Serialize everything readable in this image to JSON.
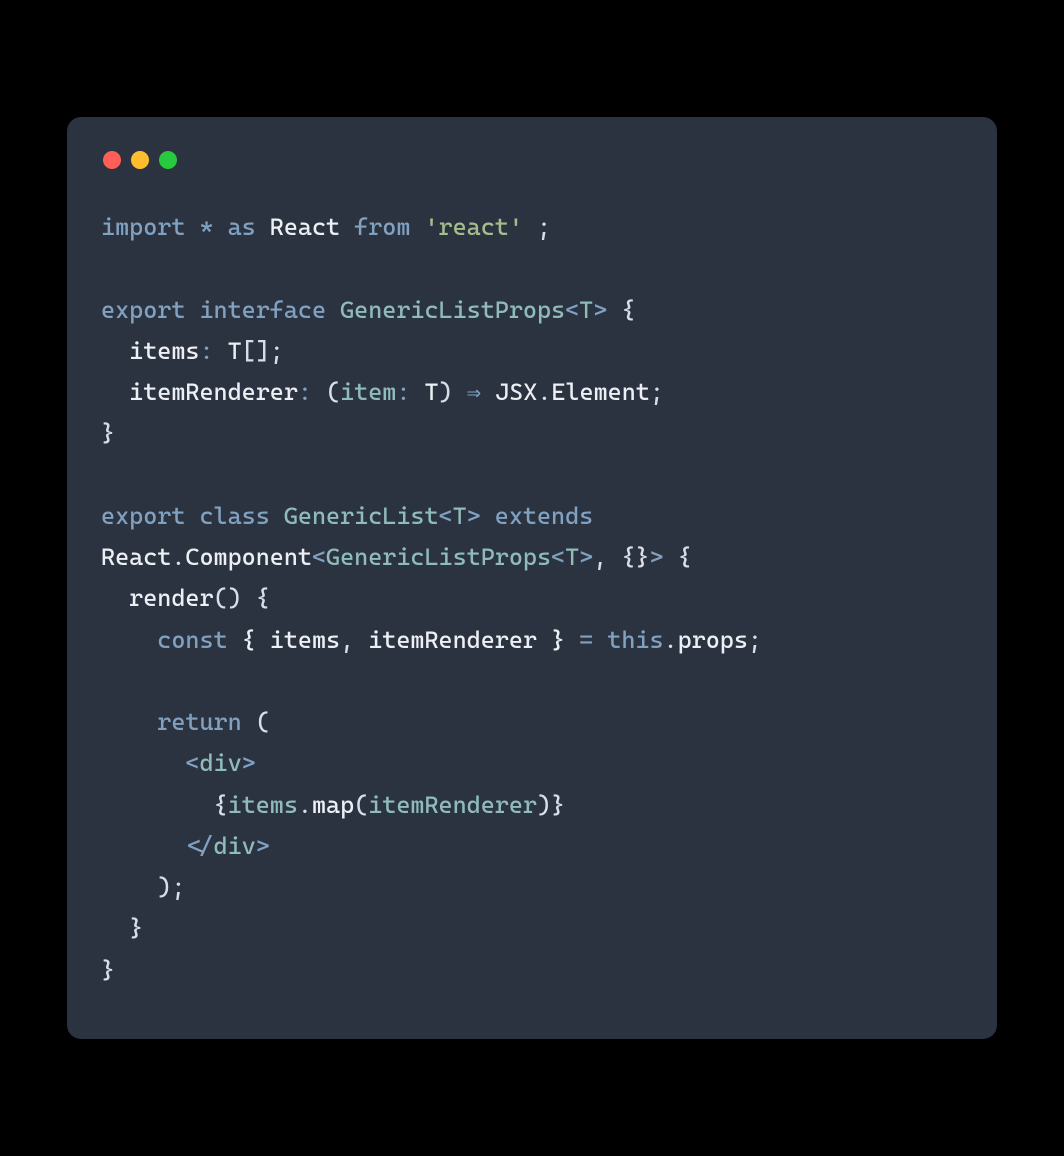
{
  "window": {
    "traffic_lights": [
      "close",
      "minimize",
      "zoom"
    ]
  },
  "code": {
    "tokens": [
      [
        {
          "t": "import",
          "c": "tok-kw"
        },
        {
          "t": " ",
          "c": ""
        },
        {
          "t": "*",
          "c": "tok-op"
        },
        {
          "t": " ",
          "c": ""
        },
        {
          "t": "as",
          "c": "tok-kw"
        },
        {
          "t": " ",
          "c": ""
        },
        {
          "t": "React",
          "c": "tok-plain"
        },
        {
          "t": " ",
          "c": ""
        },
        {
          "t": "from",
          "c": "tok-kw"
        },
        {
          "t": " ",
          "c": ""
        },
        {
          "t": "'react'",
          "c": "tok-str"
        },
        {
          "t": " ;",
          "c": "tok-punct"
        }
      ],
      [],
      [
        {
          "t": "export",
          "c": "tok-kw"
        },
        {
          "t": " ",
          "c": ""
        },
        {
          "t": "interface",
          "c": "tok-kw"
        },
        {
          "t": " ",
          "c": ""
        },
        {
          "t": "GenericListProps",
          "c": "tok-type"
        },
        {
          "t": "<",
          "c": "tok-angle"
        },
        {
          "t": "T",
          "c": "tok-type"
        },
        {
          "t": ">",
          "c": "tok-angle"
        },
        {
          "t": " {",
          "c": "tok-punct"
        }
      ],
      [
        {
          "t": "  items",
          "c": "tok-plain"
        },
        {
          "t": ":",
          "c": "tok-op"
        },
        {
          "t": " T",
          "c": "tok-plain"
        },
        {
          "t": "[];",
          "c": "tok-punct"
        }
      ],
      [
        {
          "t": "  itemRenderer",
          "c": "tok-plain"
        },
        {
          "t": ":",
          "c": "tok-op"
        },
        {
          "t": " (",
          "c": "tok-punct"
        },
        {
          "t": "item",
          "c": "tok-type"
        },
        {
          "t": ":",
          "c": "tok-op"
        },
        {
          "t": " T",
          "c": "tok-plain"
        },
        {
          "t": ") ",
          "c": "tok-punct"
        },
        {
          "t": "⇒",
          "c": "tok-op"
        },
        {
          "t": " JSX",
          "c": "tok-plain"
        },
        {
          "t": ".",
          "c": "tok-punct"
        },
        {
          "t": "Element",
          "c": "tok-plain"
        },
        {
          "t": ";",
          "c": "tok-punct"
        }
      ],
      [
        {
          "t": "}",
          "c": "tok-punct"
        }
      ],
      [],
      [
        {
          "t": "export",
          "c": "tok-kw"
        },
        {
          "t": " ",
          "c": ""
        },
        {
          "t": "class",
          "c": "tok-kw"
        },
        {
          "t": " ",
          "c": ""
        },
        {
          "t": "GenericList",
          "c": "tok-type"
        },
        {
          "t": "<",
          "c": "tok-angle"
        },
        {
          "t": "T",
          "c": "tok-type"
        },
        {
          "t": ">",
          "c": "tok-angle"
        },
        {
          "t": " ",
          "c": ""
        },
        {
          "t": "extends",
          "c": "tok-kw"
        }
      ],
      [
        {
          "t": "React",
          "c": "tok-plain"
        },
        {
          "t": ".",
          "c": "tok-punct"
        },
        {
          "t": "Component",
          "c": "tok-plain"
        },
        {
          "t": "<",
          "c": "tok-angle"
        },
        {
          "t": "GenericListProps",
          "c": "tok-type"
        },
        {
          "t": "<",
          "c": "tok-angle"
        },
        {
          "t": "T",
          "c": "tok-type"
        },
        {
          "t": ">",
          "c": "tok-angle"
        },
        {
          "t": ", {}",
          "c": "tok-punct"
        },
        {
          "t": ">",
          "c": "tok-angle"
        },
        {
          "t": " {",
          "c": "tok-punct"
        }
      ],
      [
        {
          "t": "  render",
          "c": "tok-plain"
        },
        {
          "t": "() {",
          "c": "tok-punct"
        }
      ],
      [
        {
          "t": "    ",
          "c": ""
        },
        {
          "t": "const",
          "c": "tok-kw"
        },
        {
          "t": " { items",
          "c": "tok-plain"
        },
        {
          "t": ",",
          "c": "tok-punct"
        },
        {
          "t": " itemRenderer } ",
          "c": "tok-plain"
        },
        {
          "t": "=",
          "c": "tok-op"
        },
        {
          "t": " ",
          "c": ""
        },
        {
          "t": "this",
          "c": "tok-kw"
        },
        {
          "t": ".",
          "c": "tok-punct"
        },
        {
          "t": "props",
          "c": "tok-plain"
        },
        {
          "t": ";",
          "c": "tok-punct"
        }
      ],
      [],
      [
        {
          "t": "    ",
          "c": ""
        },
        {
          "t": "return",
          "c": "tok-kw"
        },
        {
          "t": " (",
          "c": "tok-punct"
        }
      ],
      [
        {
          "t": "      ",
          "c": ""
        },
        {
          "t": "<",
          "c": "tok-angle"
        },
        {
          "t": "div",
          "c": "tok-type"
        },
        {
          "t": ">",
          "c": "tok-angle"
        }
      ],
      [
        {
          "t": "        {",
          "c": "tok-punct"
        },
        {
          "t": "items",
          "c": "tok-type"
        },
        {
          "t": ".",
          "c": "tok-punct"
        },
        {
          "t": "map",
          "c": "tok-plain"
        },
        {
          "t": "(",
          "c": "tok-punct"
        },
        {
          "t": "itemRenderer",
          "c": "tok-type"
        },
        {
          "t": ")}",
          "c": "tok-punct"
        }
      ],
      [
        {
          "t": "      ",
          "c": ""
        },
        {
          "t": "<",
          "c": "tok-angle"
        },
        {
          "t": "/",
          "c": "tok-angle"
        },
        {
          "t": "div",
          "c": "tok-type"
        },
        {
          "t": ">",
          "c": "tok-angle"
        }
      ],
      [
        {
          "t": "    );",
          "c": "tok-punct"
        }
      ],
      [
        {
          "t": "  }",
          "c": "tok-punct"
        }
      ],
      [
        {
          "t": "}",
          "c": "tok-punct"
        }
      ]
    ],
    "plain_text": "import * as React from 'react' ;\n\nexport interface GenericListProps<T> {\n  items: T[];\n  itemRenderer: (item: T) => JSX.Element;\n}\n\nexport class GenericList<T> extends\nReact.Component<GenericListProps<T>, {}> {\n  render() {\n    const { items, itemRenderer } = this.props;\n\n    return (\n      <div>\n        {items.map(itemRenderer)}\n      </div>\n    );\n  }\n}"
  },
  "colors": {
    "background_page": "#000000",
    "background_window": "#2b3240",
    "red": "#ff5f56",
    "yellow": "#ffbd2e",
    "green": "#27c93f",
    "keyword": "#81a1c1",
    "type": "#8fbcbb",
    "string": "#a3be8c",
    "default": "#d8dee9"
  }
}
